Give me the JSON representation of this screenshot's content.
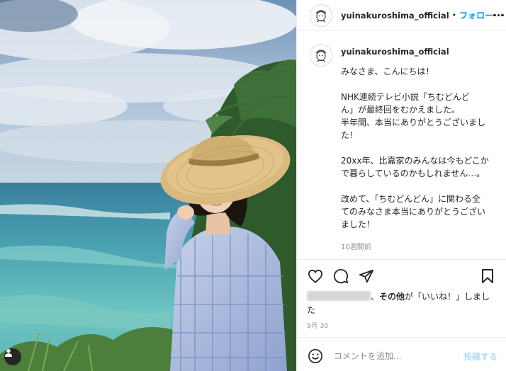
{
  "post": {
    "username": "yuinakuroshima_official",
    "separator": "•",
    "follow_label": "フォロー"
  },
  "caption": {
    "username": "yuinakuroshima_official",
    "lines": [
      "みなさま、こんにちは！",
      "",
      "NHK連続テレビ小説「ちむどんど",
      "ん」が最終回をむかえました。",
      "半年間、本当にありがとうございまし",
      "た！",
      "",
      "20xx年、比嘉家のみんなは今もどこか",
      "で暮らしているのかもしれません…。",
      "",
      "改めて、「ちむどんどん」に関わる全",
      "てのみなさま本当にありがとうござい",
      "ました！"
    ],
    "time_ago": "10週間前"
  },
  "icons": {
    "like": "heart-icon",
    "comment": "comment-bubble-icon",
    "share": "paper-plane-icon",
    "save": "bookmark-icon",
    "more": "ellipsis-icon",
    "emoji": "smiley-icon",
    "tag": "user-tag-icon"
  },
  "likes": {
    "comma": "、",
    "others": "その他",
    "suffix_line1": "が「いいね！」しまし",
    "suffix_line2": "た"
  },
  "date": "9月 30",
  "comment": {
    "placeholder": "コメントを追加...",
    "post_label": "投稿する"
  },
  "colors": {
    "accent": "#0095f6",
    "post_disabled": "#b2dffc",
    "text": "#262626",
    "muted": "#8e8e8e",
    "border": "#efefef"
  }
}
